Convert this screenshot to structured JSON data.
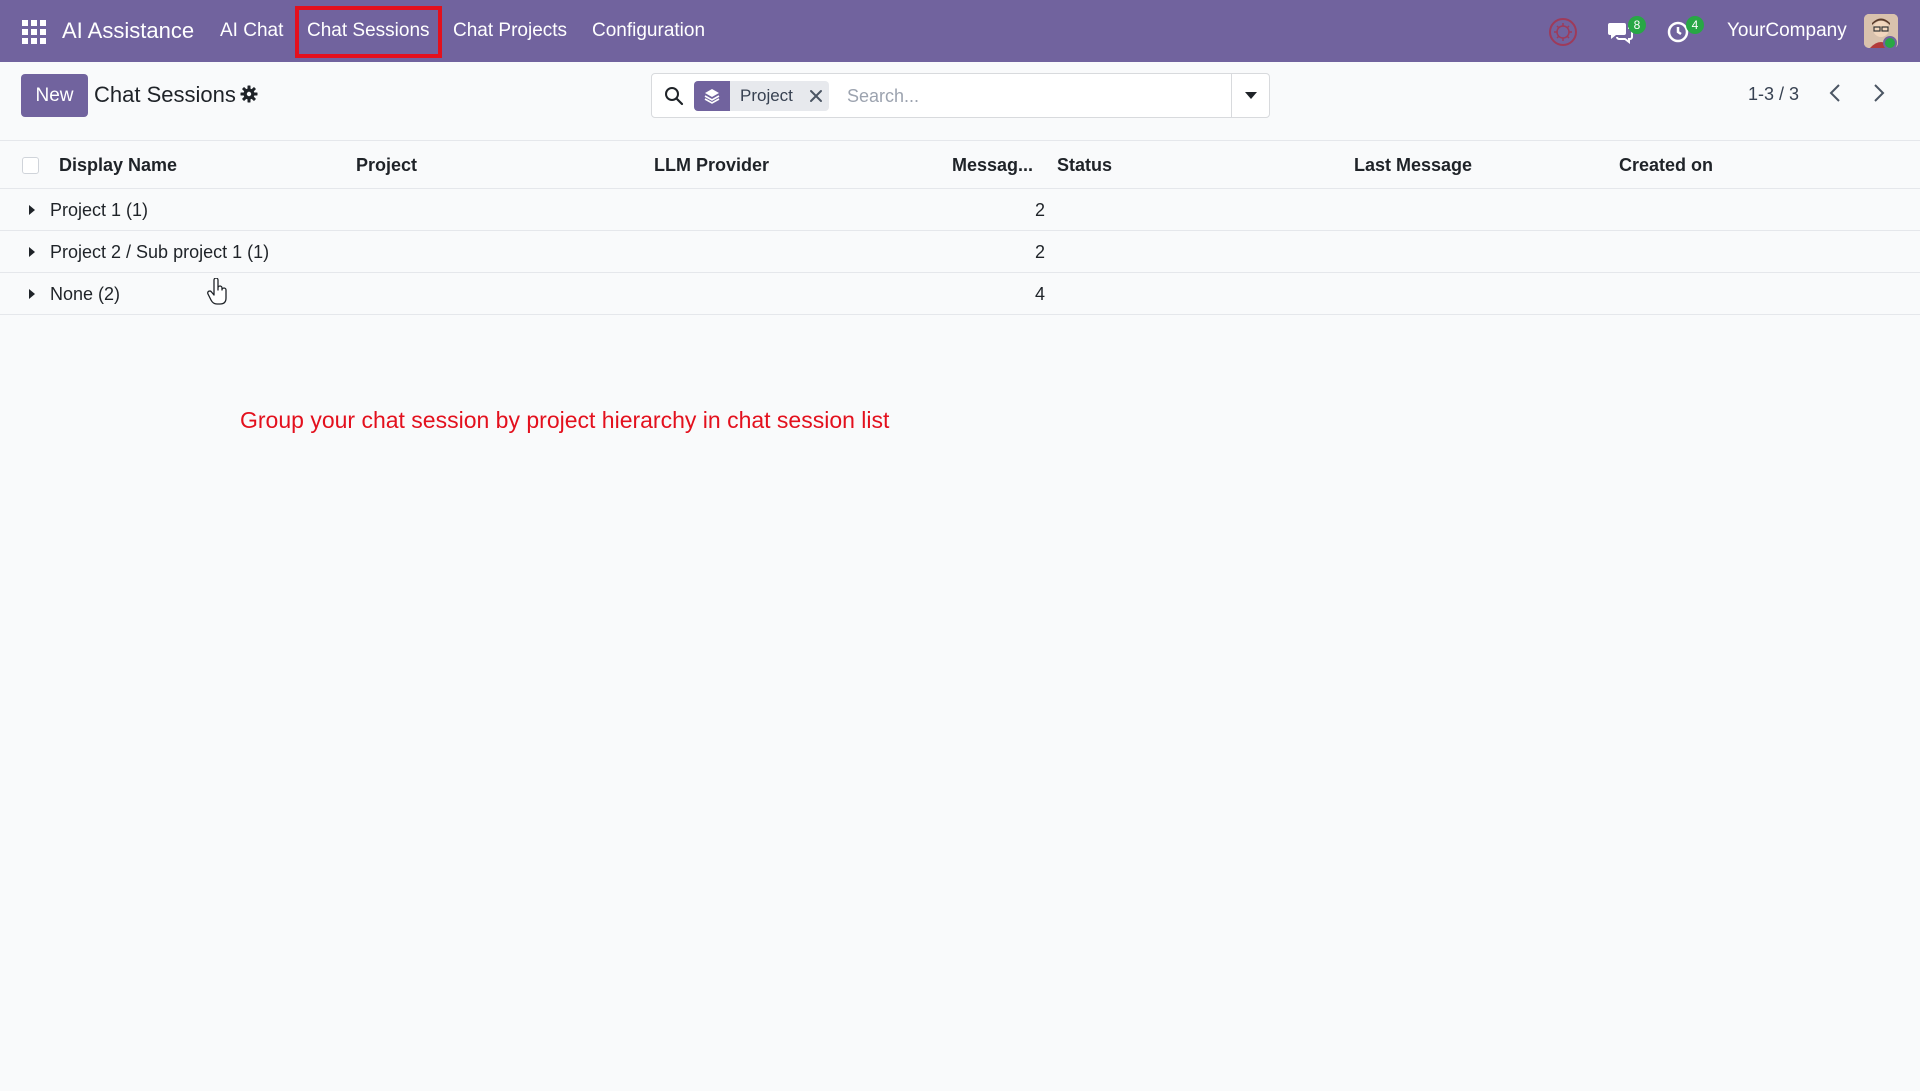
{
  "navbar": {
    "app_name": "AI Assistance",
    "menu": [
      {
        "label": "AI Chat"
      },
      {
        "label": "Chat Sessions"
      },
      {
        "label": "Chat Projects"
      },
      {
        "label": "Configuration"
      }
    ],
    "messages_badge": "8",
    "activities_badge": "4",
    "company": "YourCompany",
    "accent_color": "#71639e"
  },
  "control_panel": {
    "new_label": "New",
    "title": "Chat Sessions",
    "search": {
      "facet_label": "Project",
      "placeholder": "Search..."
    },
    "pager": "1-3 / 3"
  },
  "list": {
    "columns": [
      "Display Name",
      "Project",
      "LLM Provider",
      "Messag...",
      "Status",
      "Last Message",
      "Created on"
    ],
    "groups": [
      {
        "name": "Project 1 (1)",
        "messages": "2"
      },
      {
        "name": "Project 2 / Sub project 1 (1)",
        "messages": "2"
      },
      {
        "name": "None (2)",
        "messages": "4"
      }
    ]
  },
  "annotation": "Group your chat session by project hierarchy in chat session list",
  "annotation_color": "#e3101d"
}
